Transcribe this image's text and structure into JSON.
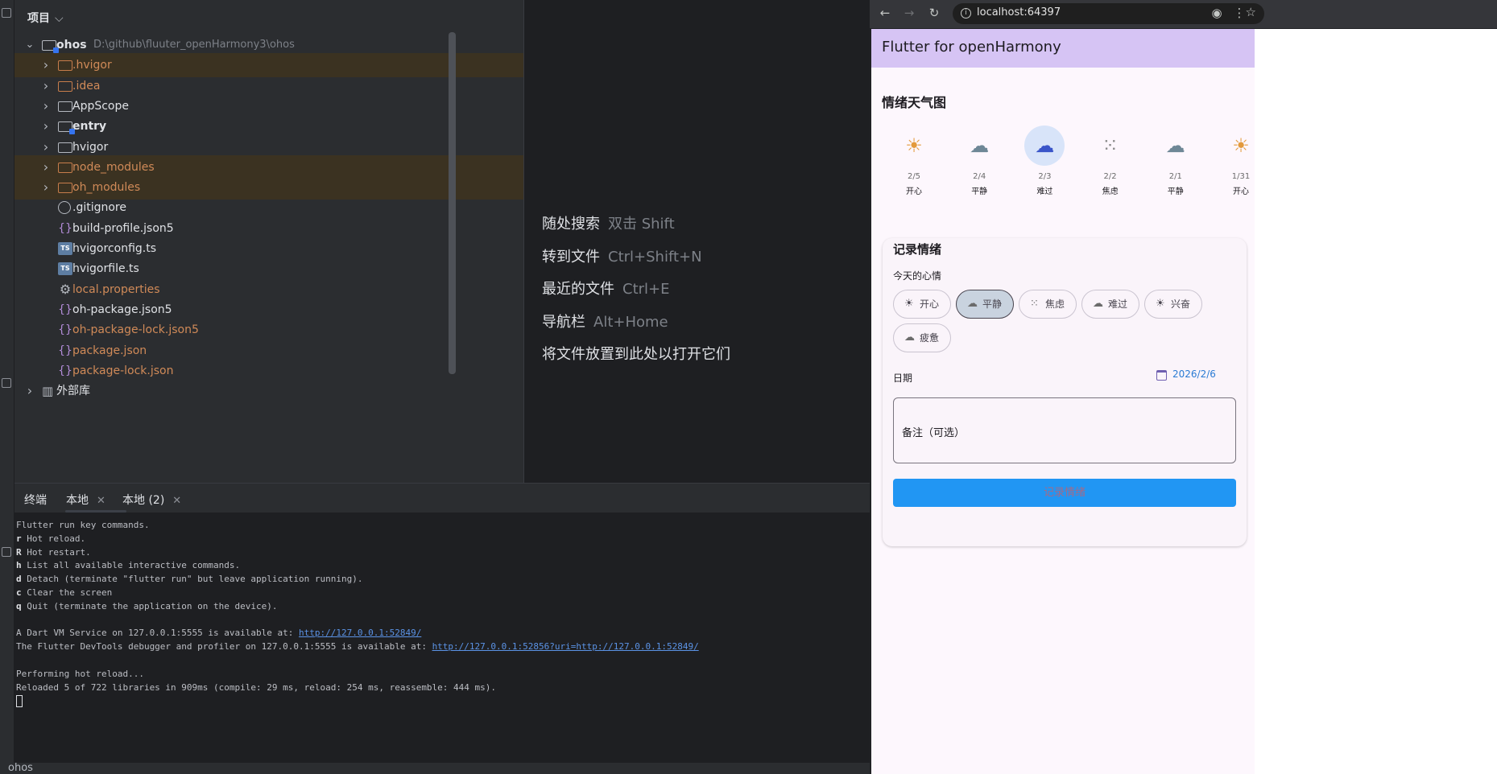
{
  "project": {
    "title": "项目",
    "items": [
      {
        "label": "ohos",
        "path": "D:\\github\\fluuter_openHarmony3\\ohos",
        "kind": "module-root",
        "arrow": "expanded",
        "color": "white-bold"
      },
      {
        "label": ".hvigor",
        "kind": "folder",
        "arrow": "collapsed",
        "color": "orange",
        "excluded": true
      },
      {
        "label": ".idea",
        "kind": "folder",
        "arrow": "collapsed",
        "color": "orange"
      },
      {
        "label": "AppScope",
        "kind": "folder",
        "arrow": "collapsed",
        "color": "white"
      },
      {
        "label": "entry",
        "kind": "module",
        "arrow": "collapsed",
        "color": "white-bold"
      },
      {
        "label": "hvigor",
        "kind": "folder",
        "arrow": "collapsed",
        "color": "white"
      },
      {
        "label": "node_modules",
        "kind": "folder",
        "arrow": "collapsed",
        "color": "orange",
        "excluded": true
      },
      {
        "label": "oh_modules",
        "kind": "folder",
        "arrow": "collapsed",
        "color": "orange",
        "excluded": true
      },
      {
        "label": ".gitignore",
        "kind": "ignore",
        "color": "white"
      },
      {
        "label": "build-profile.json5",
        "kind": "json",
        "color": "white"
      },
      {
        "label": "hvigorconfig.ts",
        "kind": "ts",
        "color": "white"
      },
      {
        "label": "hvigorfile.ts",
        "kind": "ts",
        "color": "white"
      },
      {
        "label": "local.properties",
        "kind": "gear",
        "color": "orange"
      },
      {
        "label": "oh-package.json5",
        "kind": "json",
        "color": "white"
      },
      {
        "label": "oh-package-lock.json5",
        "kind": "json",
        "color": "orange"
      },
      {
        "label": "package.json",
        "kind": "json",
        "color": "orange"
      },
      {
        "label": "package-lock.json",
        "kind": "json",
        "color": "orange"
      },
      {
        "label": "外部库",
        "kind": "library",
        "arrow": "collapsed",
        "color": "white"
      }
    ]
  },
  "editor_hints": [
    {
      "label": "随处搜索",
      "key": "双击 Shift"
    },
    {
      "label": "转到文件",
      "key": "Ctrl+Shift+N"
    },
    {
      "label": "最近的文件",
      "key": "Ctrl+E"
    },
    {
      "label": "导航栏",
      "key": "Alt+Home"
    },
    {
      "label": "将文件放置到此处以打开它们",
      "key": ""
    }
  ],
  "terminal": {
    "tab_title": "终端",
    "tabs": [
      "本地",
      "本地 (2)"
    ],
    "lines": [
      {
        "text": "Flutter run key commands."
      },
      {
        "key": "r",
        "text": " Hot reload."
      },
      {
        "key": "R",
        "text": " Hot restart."
      },
      {
        "key": "h",
        "text": " List all available interactive commands."
      },
      {
        "key": "d",
        "text": " Detach (terminate \"flutter run\" but leave application running)."
      },
      {
        "key": "c",
        "text": " Clear the screen"
      },
      {
        "key": "q",
        "text": " Quit (terminate the application on the device)."
      },
      {
        "text": ""
      },
      {
        "text": "A Dart VM Service on 127.0.0.1:5555 is available at: ",
        "link": "http://127.0.0.1:52849/"
      },
      {
        "text": "The Flutter DevTools debugger and profiler on 127.0.0.1:5555 is available at: ",
        "link": "http://127.0.0.1:52856?uri=http://127.0.0.1:52849/"
      },
      {
        "text": ""
      },
      {
        "text": "Performing hot reload..."
      },
      {
        "text": "Reloaded 5 of 722 libraries in 909ms (compile: 29 ms, reload: 254 ms, reassemble: 444 ms)."
      }
    ]
  },
  "status_bar": {
    "label": "ohos"
  },
  "browser": {
    "url": "localhost:64397",
    "app_title": "Flutter for openHarmony",
    "weather_title": "情绪天气图",
    "moods": [
      {
        "date": "2/5",
        "name": "开心",
        "icon": "sun-icon",
        "selected": false
      },
      {
        "date": "2/4",
        "name": "平静",
        "icon": "cloud-icon",
        "selected": false
      },
      {
        "date": "2/3",
        "name": "难过",
        "icon": "cloud-icon",
        "selected": true
      },
      {
        "date": "2/2",
        "name": "焦虑",
        "icon": "dots-icon",
        "selected": false
      },
      {
        "date": "2/1",
        "name": "平静",
        "icon": "cloud-icon",
        "selected": false
      },
      {
        "date": "1/31",
        "name": "开心",
        "icon": "sun-icon",
        "selected": false
      }
    ],
    "record": {
      "title": "记录情绪",
      "mood_label": "今天的心情",
      "chips": [
        {
          "label": "开心",
          "icon": "sun-icon",
          "selected": false
        },
        {
          "label": "平静",
          "icon": "cloud-icon",
          "selected": true
        },
        {
          "label": "焦虑",
          "icon": "dots-icon",
          "selected": false
        },
        {
          "label": "难过",
          "icon": "cloud-icon",
          "selected": false
        },
        {
          "label": "兴奋",
          "icon": "sun-icon",
          "selected": false
        },
        {
          "label": "疲惫",
          "icon": "cloud-icon",
          "selected": false
        }
      ],
      "date_label": "日期",
      "date_value": "2026/2/6",
      "note_placeholder": "备注（可选）",
      "submit_label": "记录情绪"
    }
  }
}
